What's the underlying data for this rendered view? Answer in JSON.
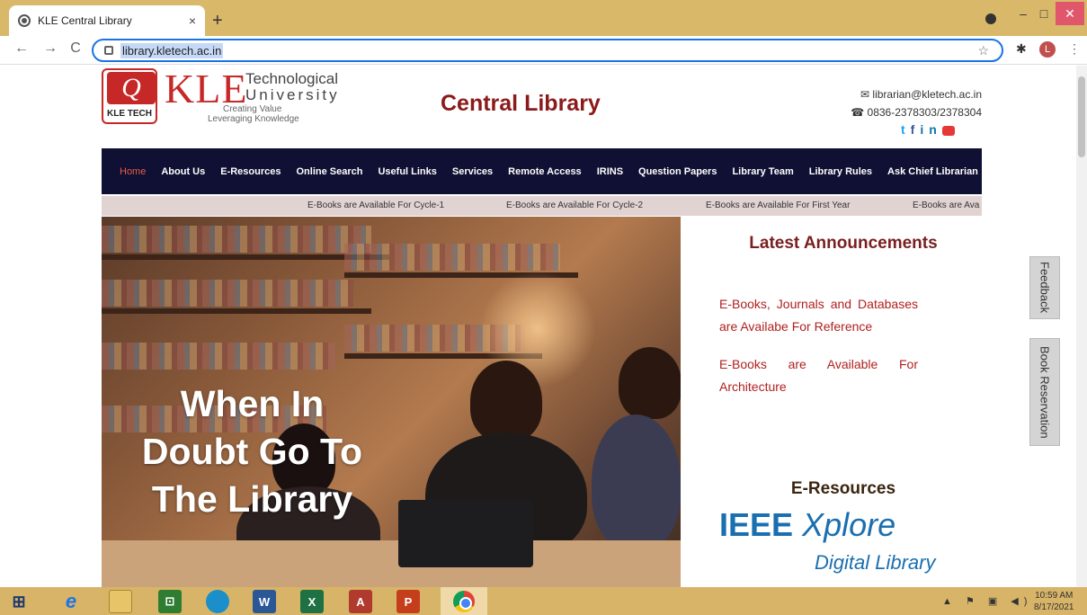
{
  "browser": {
    "tab_title": "KLE Central Library",
    "tab_close": "×",
    "new_tab": "+",
    "url": "library.kletech.ac.in",
    "profile_initial": "L",
    "win_min": "–",
    "win_max": "□",
    "win_close": "✕",
    "back": "←",
    "forward": "→",
    "reload": "C",
    "bookmark_star": "☆"
  },
  "header": {
    "logo_kle": "KLE",
    "logo_tech": "Technological",
    "logo_univ": "University",
    "logo_tag1": "Creating Value",
    "logo_tag2": "Leveraging Knowledge",
    "logo_badge": "KLE TECH",
    "site_title": "Central Library",
    "email": "librarian@kletech.ac.in",
    "phone": "0836-2378303/2378304"
  },
  "nav": {
    "items": [
      {
        "label": "Home",
        "active": true
      },
      {
        "label": "About Us"
      },
      {
        "label": "E-Resources"
      },
      {
        "label": "Online Search"
      },
      {
        "label": "Useful Links"
      },
      {
        "label": "Services"
      },
      {
        "label": "Remote Access"
      },
      {
        "label": "IRINS"
      },
      {
        "label": "Question Papers"
      },
      {
        "label": "Library Team"
      },
      {
        "label": "Library Rules"
      },
      {
        "label": "Ask Chief Librarian"
      }
    ]
  },
  "ticker": {
    "items": [
      "E-Books are Available For Cycle-1",
      "E-Books are Available For Cycle-2",
      "E-Books are Available For First Year",
      "E-Books are Ava"
    ]
  },
  "hero": {
    "lines": [
      "When In",
      "Doubt Go To",
      "The Library"
    ]
  },
  "announcements": {
    "title": "Latest Announcements",
    "items": [
      "E-Books, Journals and Databases are Availabe For Reference",
      "E-Books are Available For Architecture"
    ]
  },
  "eresources": {
    "title": "E-Resources",
    "ieee_main": "IEEE",
    "ieee_xplore": "Xplore",
    "ieee_sub": "Digital Library"
  },
  "side_buttons": {
    "feedback": "Feedback",
    "reservation": "Book Reservation"
  },
  "taskbar": {
    "time": "10:59 AM",
    "date": "8/17/2021"
  },
  "colors": {
    "brand_red": "#c62828",
    "title_maroon": "#8b1a1a",
    "nav_bg": "#0f1033",
    "nav_active": "#e85d4a",
    "announce_text": "#b02020"
  }
}
